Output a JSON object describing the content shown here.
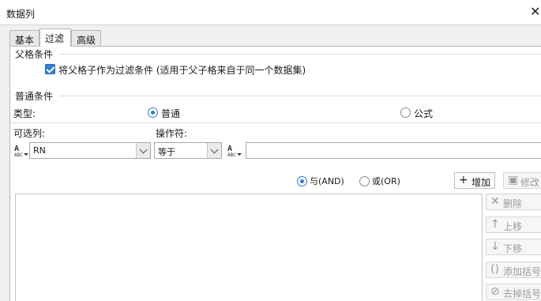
{
  "window": {
    "title": "数据列",
    "close_symbol": "✕"
  },
  "tabs": [
    {
      "label": "基本",
      "active": false
    },
    {
      "label": "过滤",
      "active": true
    },
    {
      "label": "高级",
      "active": false
    }
  ],
  "parent_condition": {
    "legend": "父格条件",
    "checkbox_label": "将父格子作为过滤条件 (适用于父子格来自于同一个数据集)",
    "checked": true
  },
  "normal_condition": {
    "legend": "普通条件",
    "type_label": "类型:",
    "type_options": [
      {
        "label": "普通",
        "selected": true
      },
      {
        "label": "公式",
        "selected": false
      }
    ],
    "column_label": "可选列:",
    "operator_label": "操作符:",
    "column_value": "RN",
    "operator_value": "等于",
    "value_field": ""
  },
  "logic": {
    "and_label": "与(AND)",
    "or_label": "或(OR)",
    "selected": "and"
  },
  "actions": {
    "add": "增加",
    "modify": "修改",
    "delete": "删除",
    "move_up": "上移",
    "move_down": "下移",
    "add_bracket": "添加括号",
    "remove_bracket": "去掉括号"
  },
  "icons": {
    "add": "plus-icon",
    "modify": "edit-icon",
    "delete": "x-icon",
    "move_up": "arrow-up-icon",
    "move_down": "arrow-down-icon",
    "add_bracket": "bracket-icon",
    "remove_bracket": "remove-bracket-icon"
  },
  "colors": {
    "accent": "#2f7ed8",
    "disabled_text": "#9a9a9a"
  }
}
